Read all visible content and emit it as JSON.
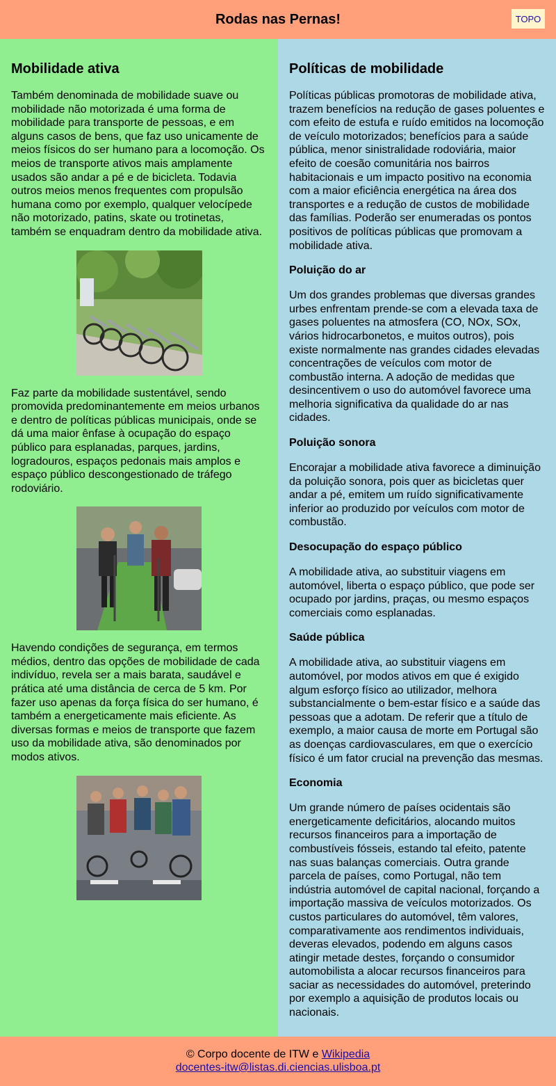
{
  "header": {
    "title": "Rodas nas Pernas!",
    "topo_label": "TOPO"
  },
  "left": {
    "heading": "Mobilidade ativa",
    "p1": "Também denominada de mobilidade suave ou mobilidade não motorizada é uma forma de mobilidade para transporte de pessoas, e em alguns casos de bens, que faz uso unicamente de meios físicos do ser humano para a locomoção. Os meios de transporte ativos mais amplamente usados são andar a pé e de bicicleta. Todavia outros meios menos frequentes com propulsão humana como por exemplo, qualquer velocípede não motorizado, patins, skate ou trotinetas, também se enquadram dentro da mobilidade ativa.",
    "p2": "Faz parte da mobilidade sustentável, sendo promovida predominantemente em meios urbanos e dentro de políticas públicas municipais, onde se dá uma maior ênfase à ocupação do espaço público para esplanadas, parques, jardins, logradouros, espaços pedonais mais amplos e espaço público descongestionado de tráfego rodoviário.",
    "p3": "Havendo condições de segurança, em termos médios, dentro das opções de mobilidade de cada indivíduo, revela ser a mais barata, saudável e prática até uma distância de cerca de 5 km. Por fazer uso apenas da força física do ser humano, é também a energeticamente mais eficiente. As diversas formas e meios de transporte que fazem uso da mobilidade ativa, são denominados por modos ativos."
  },
  "right": {
    "heading": "Políticas de mobilidade",
    "intro": "Políticas públicas promotoras de mobilidade ativa, trazem benefícios na redução de gases poluentes e com efeito de estufa e ruído emitidos na locomoção de veículo motorizados; benefícios para a saúde pública, menor sinistralidade rodoviária, maior efeito de coesão comunitária nos bairros habitacionais e um impacto positivo na economia com a maior eficiência energética na área dos transportes e a redução de custos de mobilidade das famílias. Poderão ser enumeradas os pontos positivos de políticas públicas que promovam a mobilidade ativa.",
    "sections": [
      {
        "title": "Poluição do ar",
        "text": "Um dos grandes problemas que diversas grandes urbes enfrentam prende-se com a elevada taxa de gases poluentes na atmosfera (CO, NOx, SOx, vários hidrocarbonetos, e muitos outros), pois existe normalmente nas grandes cidades elevadas concentrações de veículos com motor de combustão interna. A adoção de medidas que desincentivem o uso do automóvel favorece uma melhoria significativa da qualidade do ar nas cidades."
      },
      {
        "title": "Poluição sonora",
        "text": "Encorajar a mobilidade ativa favorece a diminuição da poluição sonora, pois quer as bicicletas quer andar a pé, emitem um ruído significativamente inferior ao produzido por veículos com motor de combustão."
      },
      {
        "title": "Desocupação do espaço público",
        "text": "A mobilidade ativa, ao substituir viagens em automóvel, liberta o espaço público, que pode ser ocupado por jardins, praças, ou mesmo espaços comerciais como esplanadas."
      },
      {
        "title": "Saúde pública",
        "text": "A mobilidade ativa, ao substituir viagens em automóvel, por modos ativos em que é exigido algum esforço físico ao utilizador, melhora substancialmente o bem-estar físico e a saúde das pessoas que a adotam. De referir que a título de exemplo, a maior causa de morte em Portugal são as doenças cardiovasculares, em que o exercício físico é um fator crucial na prevenção das mesmas."
      },
      {
        "title": "Economia",
        "text": "Um grande número de países ocidentais são energeticamente deficitários, alocando muitos recursos financeiros para a importação de combustíveis fósseis, estando tal efeito, patente nas suas balanças comerciais. Outra grande parcela de países, como Portugal, não tem indústria automóvel de capital nacional, forçando a importação massiva de veículos motorizados. Os custos particulares do automóvel, têm valores, comparativamente aos rendimentos individuais, deveras elevados, podendo em alguns casos atingir metade destes, forçando o consumidor automobilista a alocar recursos financeiros para saciar as necessidades do automóvel, preterindo por exemplo a aquisição de produtos locais ou nacionais."
      }
    ]
  },
  "footer": {
    "credit_prefix": "© Corpo docente de ITW e ",
    "wikipedia_link": "Wikipedia",
    "email_link": "docentes-itw@listas.di.ciencias.ulisboa.pt"
  },
  "colors": {
    "header_footer": "#ffa07a",
    "left_column": "#90ee90",
    "right_column": "#add8e6",
    "topo_button": "#fff5cc",
    "link": "#1a0dab"
  }
}
